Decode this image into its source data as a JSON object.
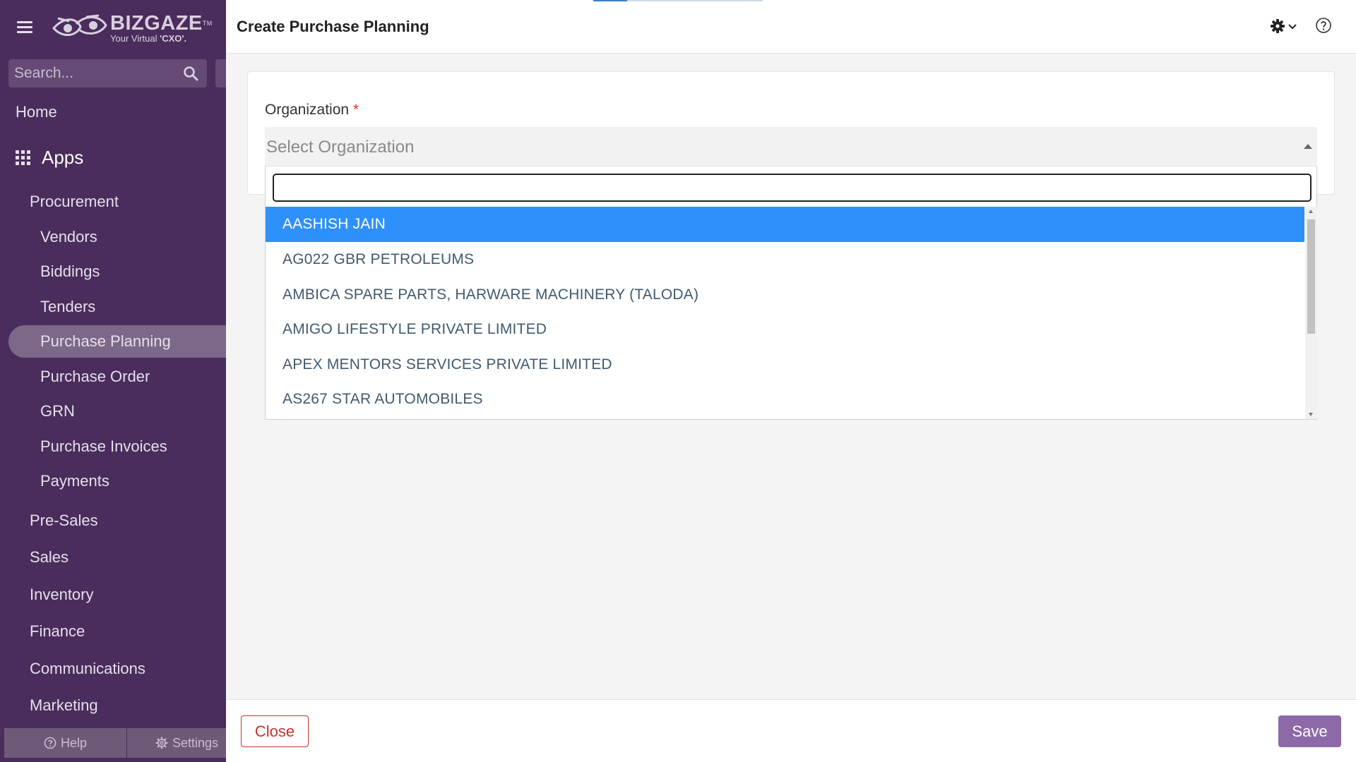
{
  "app": {
    "brand": "BIZGAZE",
    "trademark": "TM",
    "tagline_prefix": "Your Virtual ",
    "tagline_emphasis": "'CXO'."
  },
  "sidebar": {
    "search_placeholder": "Search...",
    "home": "Home",
    "apps_label": "Apps",
    "procurement": "Procurement",
    "procurement_items": [
      "Vendors",
      "Biddings",
      "Tenders",
      "Purchase Planning",
      "Purchase Order",
      "GRN",
      "Purchase Invoices",
      "Payments"
    ],
    "active_item": "Purchase Planning",
    "sections": [
      "Pre-Sales",
      "Sales",
      "Inventory",
      "Finance",
      "Communications",
      "Marketing"
    ],
    "footer": {
      "help": "Help",
      "settings": "Settings"
    }
  },
  "header": {
    "title": "Create Purchase Planning"
  },
  "form": {
    "organization_label": "Organization",
    "required_marker": "*",
    "organization_placeholder": "Select Organization"
  },
  "dropdown": {
    "search_value": "",
    "highlighted_index": 0,
    "options": [
      "AASHISH JAIN",
      "AG022 GBR PETROLEUMS",
      "AMBICA SPARE PARTS, HARWARE MACHINERY (TALODA)",
      "AMIGO LIFESTYLE PRIVATE LIMITED",
      "APEX MENTORS SERVICES PRIVATE LIMITED",
      "AS267 STAR AUTOMOBILES"
    ]
  },
  "footer": {
    "close_label": "Close",
    "save_label": "Save"
  },
  "colors": {
    "sidebar_bg": "#4a2d5c",
    "highlight": "#2e90fa",
    "save_bg": "#8d69a8",
    "close_border": "#c9302c"
  }
}
